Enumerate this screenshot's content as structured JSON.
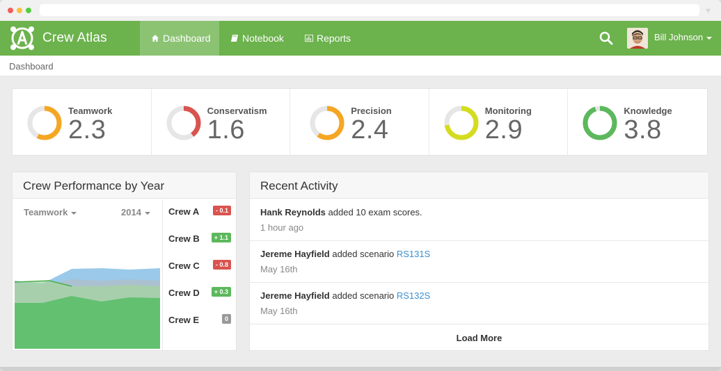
{
  "app": {
    "name": "Crew Atlas",
    "brand_color": "#6cb24d"
  },
  "nav": {
    "items": [
      {
        "label": "Dashboard",
        "icon": "home-icon",
        "active": true
      },
      {
        "label": "Notebook",
        "icon": "book-icon",
        "active": false
      },
      {
        "label": "Reports",
        "icon": "bar-chart-icon",
        "active": false
      }
    ],
    "search_icon": "search-icon",
    "user": {
      "name": "Bill Johnson",
      "avatar": "user-avatar"
    }
  },
  "breadcrumb": "Dashboard",
  "stats": [
    {
      "label": "Teamwork",
      "value": "2.3",
      "color": "#f5a623",
      "fraction": 0.575
    },
    {
      "label": "Conservatism",
      "value": "1.6",
      "color": "#d9534f",
      "fraction": 0.4
    },
    {
      "label": "Precision",
      "value": "2.4",
      "color": "#f5a623",
      "fraction": 0.6
    },
    {
      "label": "Monitoring",
      "value": "2.9",
      "color": "#d4dc1f",
      "fraction": 0.725
    },
    {
      "label": "Knowledge",
      "value": "3.8",
      "color": "#5cb85c",
      "fraction": 0.95
    }
  ],
  "performance": {
    "title": "Crew Performance by Year",
    "metric_select": "Teamwork",
    "year_select": "2014",
    "crews": [
      {
        "name": "Crew A",
        "delta": "- 0.1",
        "status": "red"
      },
      {
        "name": "Crew B",
        "delta": "+ 1.1",
        "status": "green"
      },
      {
        "name": "Crew C",
        "delta": "- 0.8",
        "status": "red"
      },
      {
        "name": "Crew D",
        "delta": "+ 0.3",
        "status": "green"
      },
      {
        "name": "Crew E",
        "delta": "0",
        "status": "gray"
      }
    ]
  },
  "activity": {
    "title": "Recent Activity",
    "items": [
      {
        "user": "Hank Reynolds",
        "text": " added 10 exam scores.",
        "link": "",
        "time": "1 hour ago"
      },
      {
        "user": "Jereme Hayfield",
        "text": " added scenario ",
        "link": "RS131S",
        "time": "May 16th"
      },
      {
        "user": "Jereme Hayfield",
        "text": " added scenario ",
        "link": "RS132S",
        "time": "May 16th"
      }
    ],
    "load_more": "Load More"
  }
}
